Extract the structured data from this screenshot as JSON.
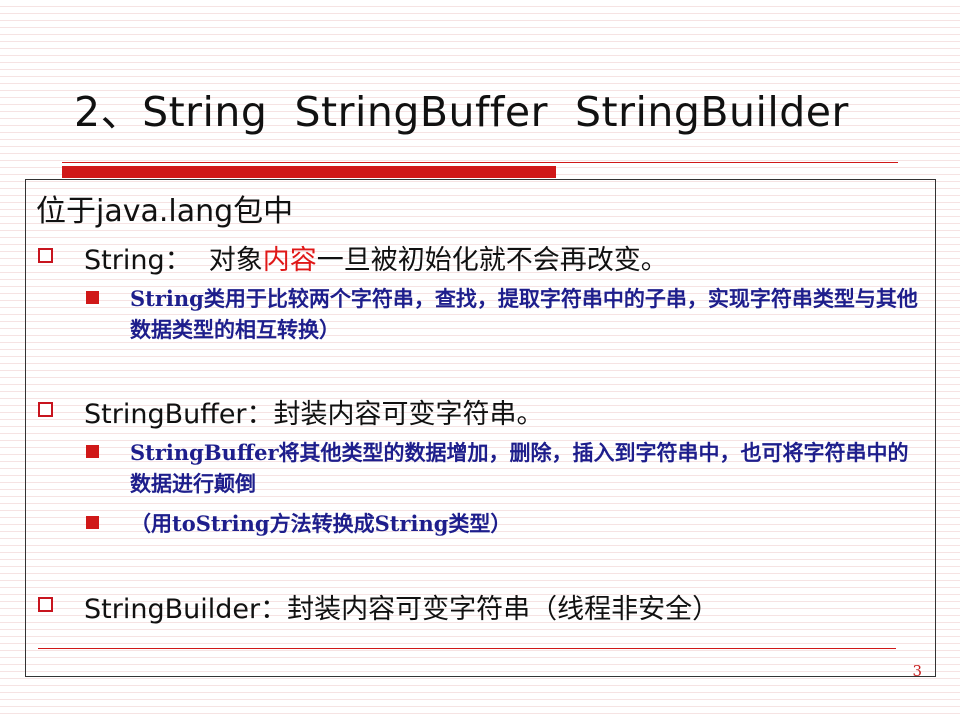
{
  "slide": {
    "title": "2、String  StringBuffer  StringBuilder",
    "page_number": "3"
  },
  "content": {
    "header": "位于java.lang包中",
    "string": {
      "label_pre": "String：  对象",
      "label_highlight": "内容",
      "label_post": "一旦被初始化就不会再改变。",
      "sub": [
        "String类用于比较两个字符串，查找，提取字符串中的子串，实现字符串类型与其他数据类型的相互转换）"
      ]
    },
    "stringbuffer": {
      "label": "StringBuffer：封装内容可变字符串。",
      "sub": [
        "StringBuffer将其他类型的数据增加，删除，插入到字符串中，也可将字符串中的数据进行颠倒",
        "（用toString方法转换成String类型）"
      ]
    },
    "stringbuilder": {
      "label": "StringBuilder：封装内容可变字符串（线程非安全）"
    }
  },
  "colors": {
    "accent_red": "#d01818",
    "sub_text_navy": "#1e1e8c",
    "highlight_red": "#e01818"
  },
  "icons": {
    "level1_bullet": "hollow-square-icon",
    "level2_bullet": "filled-square-icon"
  }
}
